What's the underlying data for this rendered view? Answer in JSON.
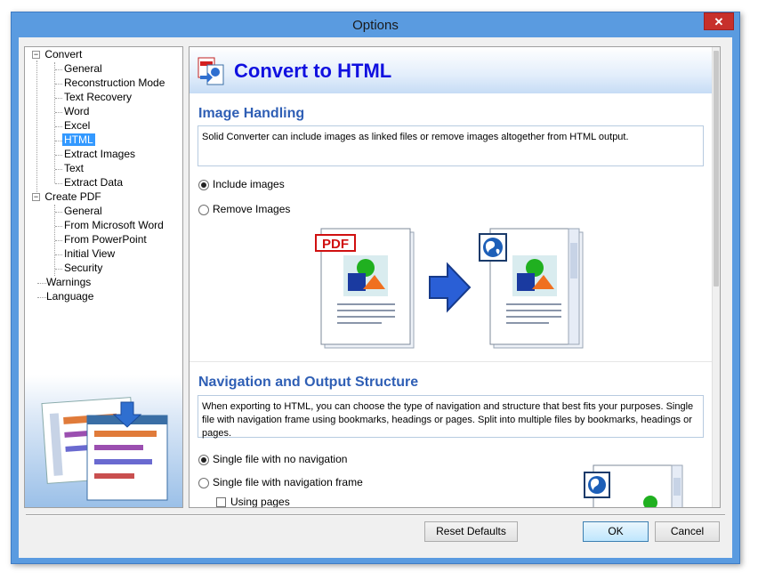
{
  "window": {
    "title": "Options",
    "close_glyph": "✕"
  },
  "tree": {
    "items": [
      {
        "label": "Convert",
        "level": 0,
        "expander": "−"
      },
      {
        "label": "General",
        "level": 1
      },
      {
        "label": "Reconstruction Mode",
        "level": 1
      },
      {
        "label": "Text Recovery",
        "level": 1
      },
      {
        "label": "Word",
        "level": 1
      },
      {
        "label": "Excel",
        "level": 1
      },
      {
        "label": "HTML",
        "level": 1,
        "selected": true
      },
      {
        "label": "Extract Images",
        "level": 1
      },
      {
        "label": "Text",
        "level": 1
      },
      {
        "label": "Extract Data",
        "level": 1
      },
      {
        "label": "Create PDF",
        "level": 0,
        "expander": "−"
      },
      {
        "label": "General",
        "level": 1
      },
      {
        "label": "From Microsoft Word",
        "level": 1
      },
      {
        "label": "From PowerPoint",
        "level": 1
      },
      {
        "label": "Initial View",
        "level": 1
      },
      {
        "label": "Security",
        "level": 1
      },
      {
        "label": "Warnings",
        "level": 0
      },
      {
        "label": "Language",
        "level": 0
      }
    ]
  },
  "content": {
    "page_title": "Convert to HTML",
    "image_handling": {
      "title": "Image Handling",
      "description": "Solid Converter can include images as linked files or remove images altogether from HTML output.",
      "options": [
        {
          "label": "Include images",
          "selected": true
        },
        {
          "label": "Remove Images",
          "selected": false
        }
      ],
      "pdf_badge": "PDF"
    },
    "navigation": {
      "title": "Navigation and Output Structure",
      "description": "When exporting to HTML, you can choose the type of navigation and structure that best fits your purposes. Single file with navigation frame using bookmarks, headings or pages. Split into multiple files by bookmarks, headings or pages.",
      "options": [
        {
          "label": "Single file with no navigation",
          "selected": true
        },
        {
          "label": "Single file with navigation frame",
          "selected": false
        }
      ],
      "sub_options": [
        {
          "label": "Using pages",
          "checked": false
        }
      ]
    }
  },
  "buttons": {
    "reset": "Reset Defaults",
    "ok": "OK",
    "cancel": "Cancel"
  },
  "colors": {
    "accent": "#1010e0",
    "section": "#2f5fb5",
    "selection": "#3399ff",
    "frame": "#5a9be0"
  }
}
